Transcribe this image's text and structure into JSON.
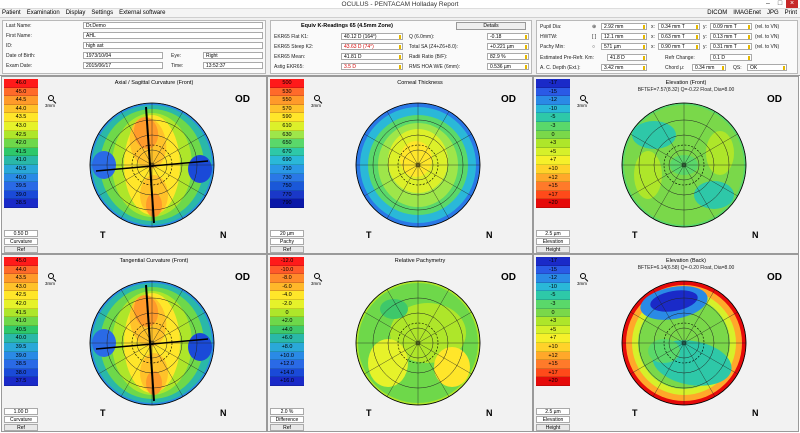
{
  "window": {
    "title": "OCULUS  -  PENTACAM   Holladay Report"
  },
  "menu": {
    "left": [
      "Patient",
      "Examination",
      "Display",
      "Settings",
      "External software"
    ],
    "right": [
      "DICOM",
      "IMAGEnet",
      "JPG",
      "Print"
    ]
  },
  "patient": {
    "last_name_label": "Last Name:",
    "last_name": "Dr.Demo",
    "first_name_label": "First Name:",
    "first_name": "AHL",
    "id_label": "ID:",
    "id": "high ast",
    "dob_label": "Date of Birth:",
    "dob": "1973/10/04",
    "eye_label": "Eye:",
    "eye": "Right",
    "exam_date_label": "Exam Date:",
    "exam_date": "2015/06/17",
    "time_label": "Time:",
    "time": "13:52:37"
  },
  "kread": {
    "header": "Equiv K-Readings 65 (4.5mm Zone)",
    "details_button": "Details",
    "rows_left": [
      {
        "label": "EKR65 Flat K1:",
        "value": "40.12 D (164°)",
        "red": false
      },
      {
        "label": "EKR65 Steep K2:",
        "value": "43.63 D (74°)",
        "red": true
      },
      {
        "label": "EKR65 Mean:",
        "value": "41.81 D",
        "red": false
      },
      {
        "label": "Astig EKR65:",
        "value": "3.5 D",
        "red": true
      }
    ],
    "rows_right": [
      {
        "label": "Q (6.0mm):",
        "value": "-0.18"
      },
      {
        "label": "Total SA (Z4+Z6+8.0):",
        "value": "+0.221 µm"
      },
      {
        "label": "Radii Ratio (B/F):",
        "value": "82.9 %"
      },
      {
        "label": "RMS HOA W/E (6mm):",
        "value": "0.536 µm"
      }
    ]
  },
  "pupil": {
    "rows": [
      {
        "label": "Pupil Dia:",
        "sym": "⊕",
        "v1": "2.92 mm",
        "x": "x:",
        "v2": "0.34 mm T",
        "y": "y:",
        "v3": "0.09 mm T",
        "rel": "(rel. to VN)"
      },
      {
        "label": "HWTW:",
        "sym": "[ ]",
        "v1": "12.1 mm",
        "x": "x:",
        "v2": "0.63 mm T",
        "y": "y:",
        "v3": "0.13 mm T",
        "rel": "(rel. to VN)"
      },
      {
        "label": "Pachy Min:",
        "sym": "○",
        "v1": "571 µm",
        "x": "x:",
        "v2": "0.90 mm T",
        "y": "y:",
        "v3": "0.31 mm T",
        "rel": "(rel. to VN)"
      }
    ],
    "est_label": "Estimated Pre-Refr. Km:",
    "est": "41.8 D",
    "rchange_label": "Refr Change:",
    "rchange": "0.1 D",
    "acd_label": "A. C. Depth (Ext.):",
    "acd": "3.42 mm",
    "chord_label": "Chord μ:",
    "chord": "0.34 mm",
    "qs_label": "QS:",
    "qs": "OK"
  },
  "panels": [
    {
      "title": "Axial / Sagittal Curvature (Front)",
      "subtitle": "",
      "eye": "OD",
      "mag": "3mm",
      "scale": [
        "46.0",
        "45.0",
        "44.5",
        "44.0",
        "43.5",
        "43.0",
        "42.5",
        "42.0",
        "41.5",
        "41.0",
        "40.5",
        "40.0",
        "39.5",
        "39.0",
        "38.5"
      ],
      "foot": [
        "0.50 D",
        "Curvature",
        "Ref"
      ],
      "sides": [
        "T",
        "N"
      ],
      "type": "axial"
    },
    {
      "title": "Corneal Thickness",
      "subtitle": "",
      "eye": "OD",
      "mag": "3mm",
      "scale": [
        "500",
        "530",
        "550",
        "570",
        "590",
        "610",
        "630",
        "650",
        "670",
        "690",
        "710",
        "730",
        "750",
        "770",
        "790"
      ],
      "foot": [
        "20 µm",
        "Pachy",
        "Ref"
      ],
      "sides": [
        "T",
        "N"
      ],
      "type": "pachy"
    },
    {
      "title": "Elevation (Front)",
      "subtitle": "BFTEF=7.57(8.32) Q=-0.22 Float, Dia=8.00",
      "eye": "OD",
      "mag": "3mm",
      "scale": [
        "-17",
        "-15",
        "-12",
        "-10",
        "-5",
        "-3",
        "0",
        "+3",
        "+5",
        "+7",
        "+10",
        "+12",
        "+15",
        "+17",
        "+20"
      ],
      "foot": [
        "2.5 µm",
        "Elevation",
        "Height"
      ],
      "sides": [
        "T",
        "N"
      ],
      "type": "elev_front"
    },
    {
      "title": "Tangential Curvature (Front)",
      "subtitle": "",
      "eye": "OD",
      "mag": "3mm",
      "scale": [
        "45.0",
        "44.0",
        "43.5",
        "43.0",
        "42.5",
        "42.0",
        "41.5",
        "41.0",
        "40.5",
        "40.0",
        "39.5",
        "39.0",
        "38.5",
        "38.0",
        "37.5"
      ],
      "foot": [
        "1.00 D",
        "Curvature",
        "Ref"
      ],
      "sides": [
        "T",
        "N"
      ],
      "type": "tangential"
    },
    {
      "title": "Relative Pachymetry",
      "subtitle": "",
      "eye": "OD",
      "mag": "3mm",
      "scale": [
        "-12.0",
        "-10.0",
        "-8.0",
        "-6.0",
        "-4.0",
        "-2.0",
        "0",
        "+2.0",
        "+4.0",
        "+6.0",
        "+8.0",
        "+10.0",
        "+12.0",
        "+14.0",
        "+16.0"
      ],
      "foot": [
        "2.0 %",
        "Difference",
        "Ref"
      ],
      "sides": [
        "T",
        "N"
      ],
      "type": "relpachy"
    },
    {
      "title": "Elevation (Back)",
      "subtitle": "BFTEF=6.14(6.58) Q=-0.20 Float, Dia=8.00",
      "eye": "OD",
      "mag": "3mm",
      "scale": [
        "-17",
        "-15",
        "-12",
        "-10",
        "-5",
        "-3",
        "0",
        "+3",
        "+5",
        "+7",
        "+10",
        "+12",
        "+15",
        "+17",
        "+20"
      ],
      "foot": [
        "2.5 µm",
        "Elevation",
        "Height"
      ],
      "sides": [
        "T",
        "N"
      ],
      "type": "elev_back"
    }
  ],
  "colors": {
    "axial_scale": [
      "#ff1a1a",
      "#ff6a2a",
      "#ff9a2a",
      "#ffc22a",
      "#ffe62a",
      "#e6f22a",
      "#aee62a",
      "#6ed84a",
      "#2ec86a",
      "#2ab8a8",
      "#2aa8d8",
      "#2a8ae6",
      "#2a6ae6",
      "#1a4ad8",
      "#1a2ac8"
    ],
    "pachy_scale": [
      "#ff1a1a",
      "#ff6a2a",
      "#ff9a2a",
      "#ffc22a",
      "#ffe62a",
      "#dcf02a",
      "#9ee64a",
      "#5ad86a",
      "#2ec8a8",
      "#2ab8d8",
      "#2a98e6",
      "#2a78e6",
      "#1a58d8",
      "#1a38c8",
      "#0a18a8"
    ],
    "elev_scale": [
      "#1a2ac8",
      "#2a5ae6",
      "#2a8ae6",
      "#2ab8d8",
      "#2ec8a8",
      "#5ad86a",
      "#7ad84a",
      "#aee62a",
      "#d6f02a",
      "#f6f02a",
      "#ffd22a",
      "#ffa82a",
      "#ff7a2a",
      "#ff4a1a",
      "#e60a0a"
    ],
    "tan_scale": [
      "#ff1a1a",
      "#ff6a2a",
      "#ff9a2a",
      "#ffc22a",
      "#ffe62a",
      "#e6f22a",
      "#aee62a",
      "#6ed84a",
      "#2ec86a",
      "#2ab8a8",
      "#2aa8d8",
      "#2a8ae6",
      "#2a6ae6",
      "#1a4ad8",
      "#1a2ac8"
    ],
    "rel_scale": [
      "#ff1a1a",
      "#ff5a2a",
      "#ff8a2a",
      "#ffb82a",
      "#ffe62a",
      "#e6f22a",
      "#aee62a",
      "#6ed84a",
      "#3ec86a",
      "#2ab8a8",
      "#2aa8d8",
      "#2a8ae6",
      "#2a6ae6",
      "#1a4ad8",
      "#1a2ac8"
    ],
    "accent_red": "#d00000"
  }
}
